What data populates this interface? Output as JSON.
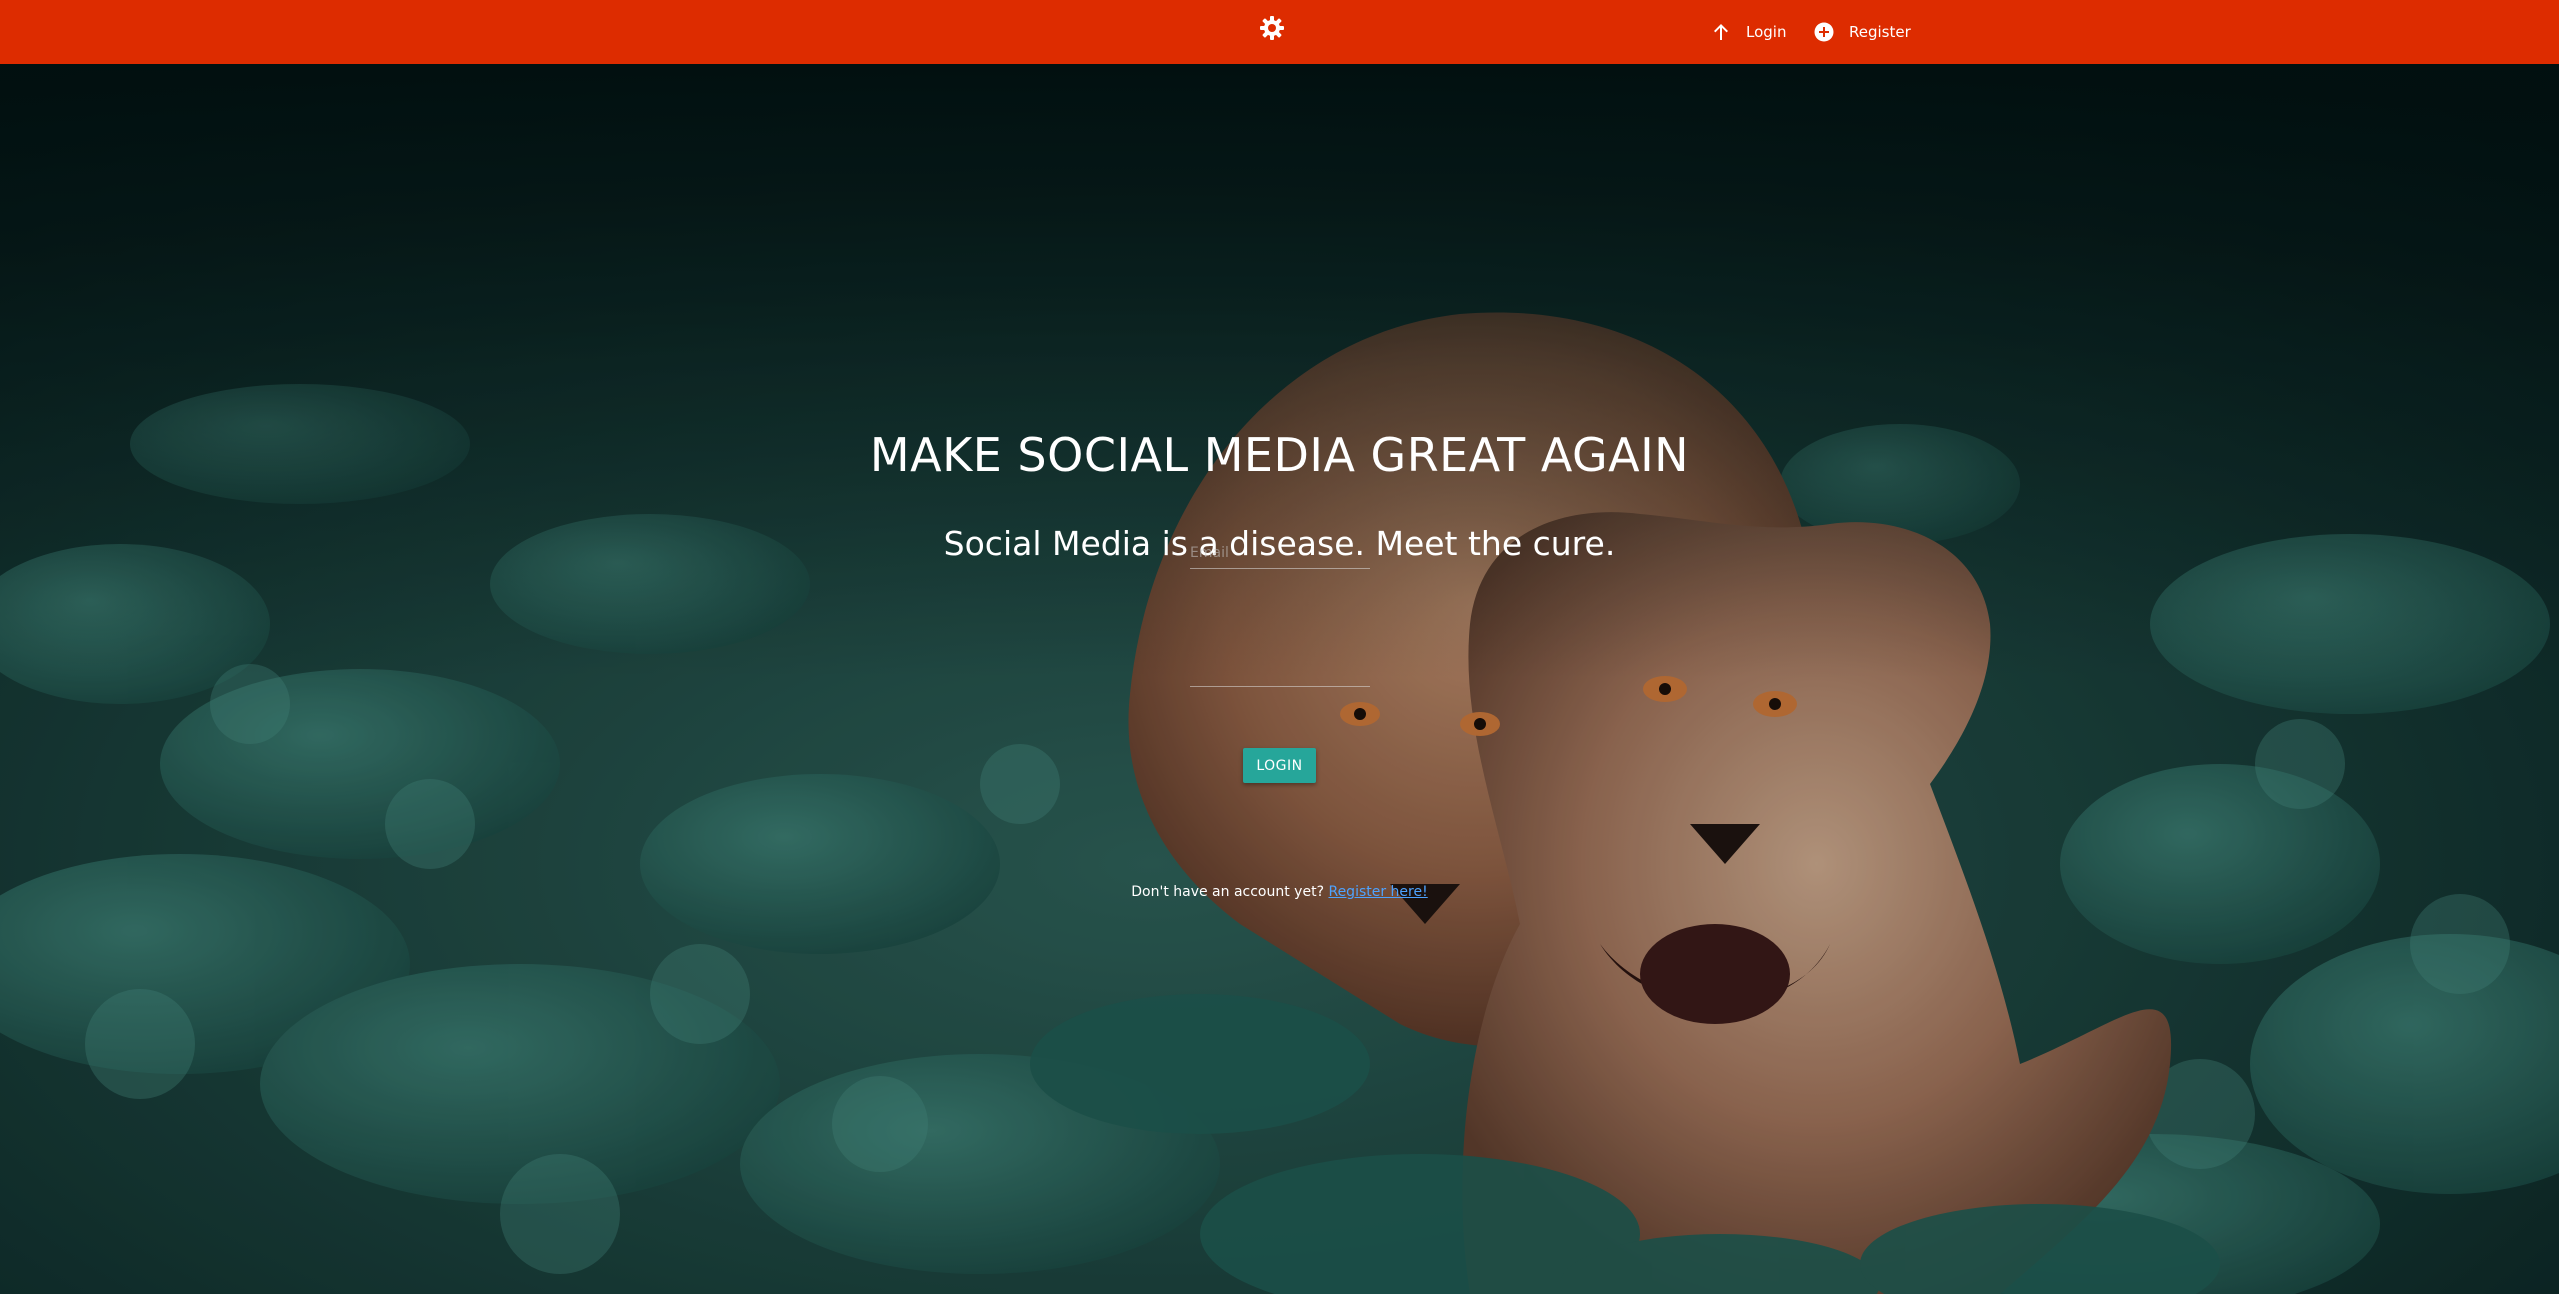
{
  "theme": {
    "navbar_color": "#dd2c00",
    "button_color": "#26a69a",
    "link_color": "#4ea3ff"
  },
  "nav": {
    "brand_icon": "gear-icon",
    "links": [
      {
        "label": "Login",
        "icon": "arrow-up-icon"
      },
      {
        "label": "Register",
        "icon": "add-circle-icon"
      }
    ]
  },
  "hero": {
    "title": "MAKE SOCIAL MEDIA GREAT AGAIN",
    "subtitle": "Social Media is a disease. Meet the cure.",
    "background": "photo of two lionesses in green clover foliage"
  },
  "form": {
    "email_placeholder": "Email",
    "email_value": "",
    "password_placeholder": "",
    "password_value": "",
    "submit_label": "LOGIN"
  },
  "register_prompt": {
    "text": "Don't have an account yet?",
    "link_label": "Register here!"
  }
}
